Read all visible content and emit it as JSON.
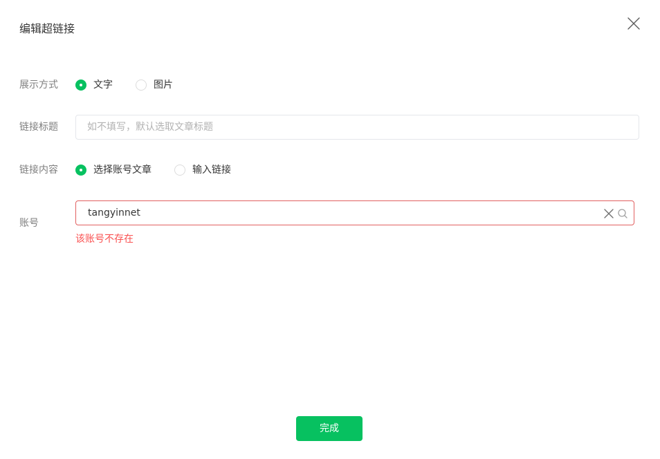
{
  "dialog": {
    "title": "编辑超链接",
    "close_icon": "close-icon"
  },
  "display_mode": {
    "label": "展示方式",
    "options": [
      {
        "label": "文字",
        "checked": true
      },
      {
        "label": "图片",
        "checked": false
      }
    ]
  },
  "link_title": {
    "label": "链接标题",
    "value": "",
    "placeholder": "如不填写，默认选取文章标题"
  },
  "link_content": {
    "label": "链接内容",
    "options": [
      {
        "label": "选择账号文章",
        "checked": true
      },
      {
        "label": "输入链接",
        "checked": false
      }
    ]
  },
  "account": {
    "label": "账号",
    "value": "tangyinnet",
    "clear_icon": "clear-icon",
    "search_icon": "search-icon",
    "error": "该账号不存在"
  },
  "footer": {
    "done_label": "完成"
  },
  "colors": {
    "primary": "#07c160",
    "error": "#fa5151",
    "error_border": "#e15f5f",
    "label": "#7f7f7f",
    "text": "#353535"
  }
}
